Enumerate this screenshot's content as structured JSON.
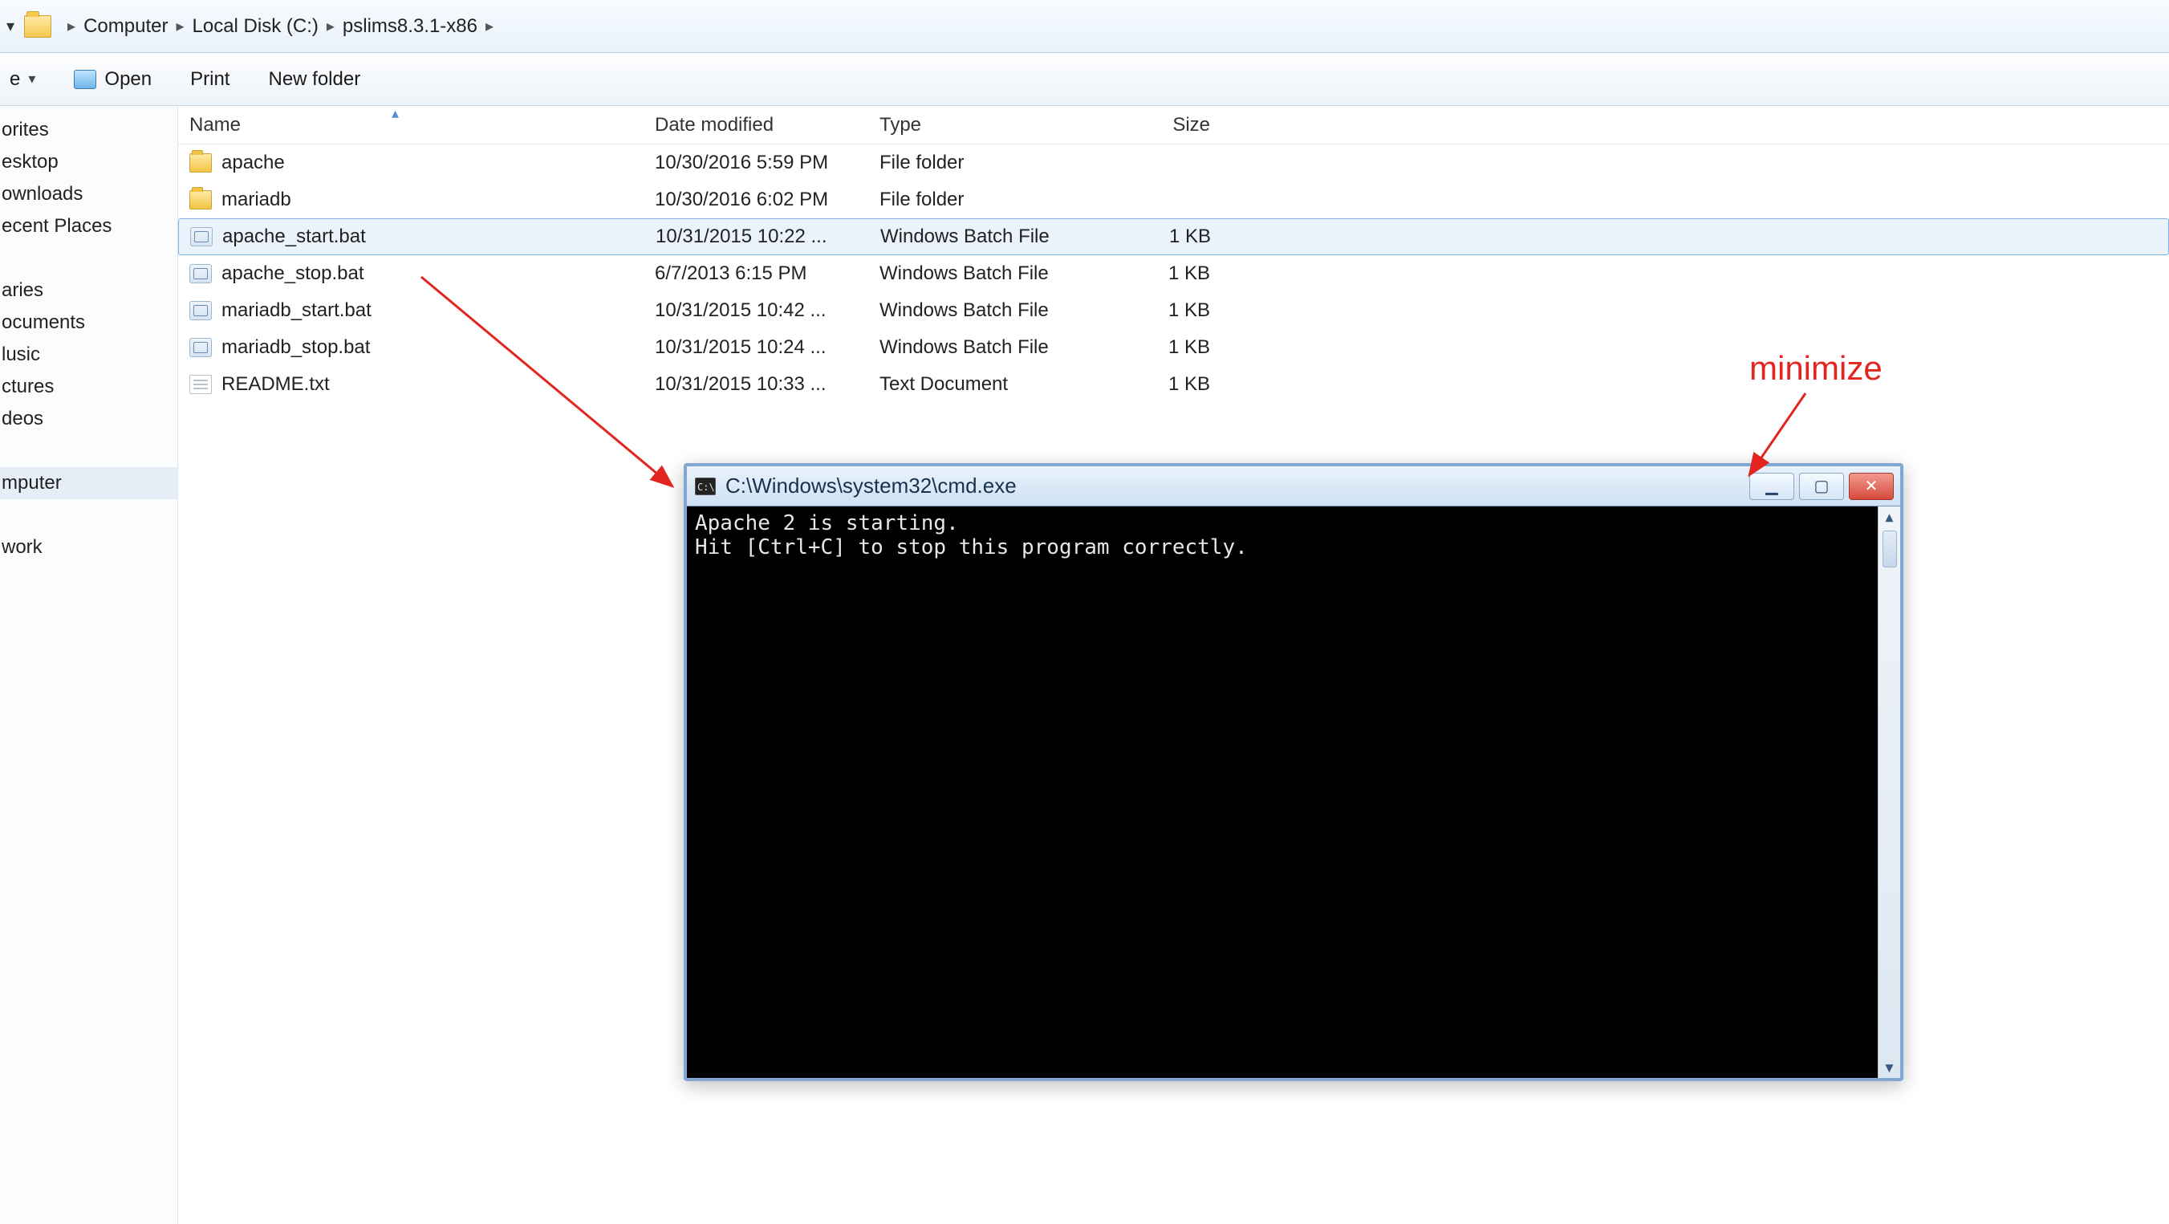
{
  "breadcrumb": {
    "items": [
      "Computer",
      "Local Disk (C:)",
      "pslims8.3.1-x86"
    ]
  },
  "toolbar": {
    "org_dropdown": "e",
    "open": "Open",
    "print": "Print",
    "new_folder": "New folder"
  },
  "sidebar": {
    "group1": [
      "orites",
      "esktop",
      "ownloads",
      "ecent Places"
    ],
    "group2": [
      "aries",
      "ocuments",
      "lusic",
      "ctures",
      "deos"
    ],
    "group3": [
      "mputer"
    ],
    "group4": [
      "work"
    ]
  },
  "columns": {
    "name": "Name",
    "date": "Date modified",
    "type": "Type",
    "size": "Size"
  },
  "files": [
    {
      "icon": "folder",
      "name": "apache",
      "date": "10/30/2016 5:59 PM",
      "type": "File folder",
      "size": ""
    },
    {
      "icon": "folder",
      "name": "mariadb",
      "date": "10/30/2016 6:02 PM",
      "type": "File folder",
      "size": ""
    },
    {
      "icon": "bat",
      "name": "apache_start.bat",
      "date": "10/31/2015 10:22 ...",
      "type": "Windows Batch File",
      "size": "1 KB",
      "selected": true
    },
    {
      "icon": "bat",
      "name": "apache_stop.bat",
      "date": "6/7/2013 6:15 PM",
      "type": "Windows Batch File",
      "size": "1 KB"
    },
    {
      "icon": "bat",
      "name": "mariadb_start.bat",
      "date": "10/31/2015 10:42 ...",
      "type": "Windows Batch File",
      "size": "1 KB"
    },
    {
      "icon": "bat",
      "name": "mariadb_stop.bat",
      "date": "10/31/2015 10:24 ...",
      "type": "Windows Batch File",
      "size": "1 KB"
    },
    {
      "icon": "txt",
      "name": "README.txt",
      "date": "10/31/2015 10:33 ...",
      "type": "Text Document",
      "size": "1 KB"
    }
  ],
  "cmd": {
    "title": "C:\\Windows\\system32\\cmd.exe",
    "lines": [
      "Apache 2 is starting.",
      "Hit [Ctrl+C] to stop this program correctly."
    ]
  },
  "annotation": {
    "label": "minimize"
  }
}
